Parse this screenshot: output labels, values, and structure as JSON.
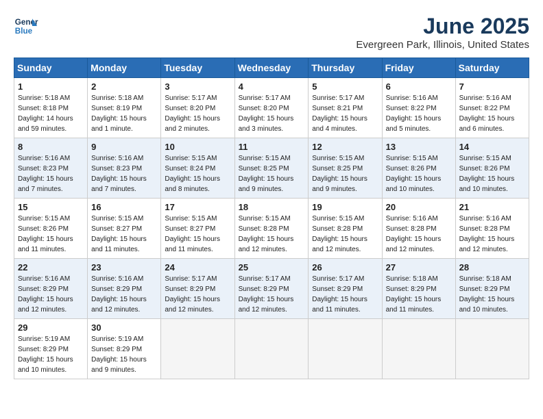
{
  "logo": {
    "line1": "General",
    "line2": "Blue"
  },
  "title": "June 2025",
  "subtitle": "Evergreen Park, Illinois, United States",
  "days_of_week": [
    "Sunday",
    "Monday",
    "Tuesday",
    "Wednesday",
    "Thursday",
    "Friday",
    "Saturday"
  ],
  "weeks": [
    [
      {
        "day": "1",
        "info": "Sunrise: 5:18 AM\nSunset: 8:18 PM\nDaylight: 14 hours\nand 59 minutes."
      },
      {
        "day": "2",
        "info": "Sunrise: 5:18 AM\nSunset: 8:19 PM\nDaylight: 15 hours\nand 1 minute."
      },
      {
        "day": "3",
        "info": "Sunrise: 5:17 AM\nSunset: 8:20 PM\nDaylight: 15 hours\nand 2 minutes."
      },
      {
        "day": "4",
        "info": "Sunrise: 5:17 AM\nSunset: 8:20 PM\nDaylight: 15 hours\nand 3 minutes."
      },
      {
        "day": "5",
        "info": "Sunrise: 5:17 AM\nSunset: 8:21 PM\nDaylight: 15 hours\nand 4 minutes."
      },
      {
        "day": "6",
        "info": "Sunrise: 5:16 AM\nSunset: 8:22 PM\nDaylight: 15 hours\nand 5 minutes."
      },
      {
        "day": "7",
        "info": "Sunrise: 5:16 AM\nSunset: 8:22 PM\nDaylight: 15 hours\nand 6 minutes."
      }
    ],
    [
      {
        "day": "8",
        "info": "Sunrise: 5:16 AM\nSunset: 8:23 PM\nDaylight: 15 hours\nand 7 minutes."
      },
      {
        "day": "9",
        "info": "Sunrise: 5:16 AM\nSunset: 8:23 PM\nDaylight: 15 hours\nand 7 minutes."
      },
      {
        "day": "10",
        "info": "Sunrise: 5:15 AM\nSunset: 8:24 PM\nDaylight: 15 hours\nand 8 minutes."
      },
      {
        "day": "11",
        "info": "Sunrise: 5:15 AM\nSunset: 8:25 PM\nDaylight: 15 hours\nand 9 minutes."
      },
      {
        "day": "12",
        "info": "Sunrise: 5:15 AM\nSunset: 8:25 PM\nDaylight: 15 hours\nand 9 minutes."
      },
      {
        "day": "13",
        "info": "Sunrise: 5:15 AM\nSunset: 8:26 PM\nDaylight: 15 hours\nand 10 minutes."
      },
      {
        "day": "14",
        "info": "Sunrise: 5:15 AM\nSunset: 8:26 PM\nDaylight: 15 hours\nand 10 minutes."
      }
    ],
    [
      {
        "day": "15",
        "info": "Sunrise: 5:15 AM\nSunset: 8:26 PM\nDaylight: 15 hours\nand 11 minutes."
      },
      {
        "day": "16",
        "info": "Sunrise: 5:15 AM\nSunset: 8:27 PM\nDaylight: 15 hours\nand 11 minutes."
      },
      {
        "day": "17",
        "info": "Sunrise: 5:15 AM\nSunset: 8:27 PM\nDaylight: 15 hours\nand 11 minutes."
      },
      {
        "day": "18",
        "info": "Sunrise: 5:15 AM\nSunset: 8:28 PM\nDaylight: 15 hours\nand 12 minutes."
      },
      {
        "day": "19",
        "info": "Sunrise: 5:15 AM\nSunset: 8:28 PM\nDaylight: 15 hours\nand 12 minutes."
      },
      {
        "day": "20",
        "info": "Sunrise: 5:16 AM\nSunset: 8:28 PM\nDaylight: 15 hours\nand 12 minutes."
      },
      {
        "day": "21",
        "info": "Sunrise: 5:16 AM\nSunset: 8:28 PM\nDaylight: 15 hours\nand 12 minutes."
      }
    ],
    [
      {
        "day": "22",
        "info": "Sunrise: 5:16 AM\nSunset: 8:29 PM\nDaylight: 15 hours\nand 12 minutes."
      },
      {
        "day": "23",
        "info": "Sunrise: 5:16 AM\nSunset: 8:29 PM\nDaylight: 15 hours\nand 12 minutes."
      },
      {
        "day": "24",
        "info": "Sunrise: 5:17 AM\nSunset: 8:29 PM\nDaylight: 15 hours\nand 12 minutes."
      },
      {
        "day": "25",
        "info": "Sunrise: 5:17 AM\nSunset: 8:29 PM\nDaylight: 15 hours\nand 12 minutes."
      },
      {
        "day": "26",
        "info": "Sunrise: 5:17 AM\nSunset: 8:29 PM\nDaylight: 15 hours\nand 11 minutes."
      },
      {
        "day": "27",
        "info": "Sunrise: 5:18 AM\nSunset: 8:29 PM\nDaylight: 15 hours\nand 11 minutes."
      },
      {
        "day": "28",
        "info": "Sunrise: 5:18 AM\nSunset: 8:29 PM\nDaylight: 15 hours\nand 10 minutes."
      }
    ],
    [
      {
        "day": "29",
        "info": "Sunrise: 5:19 AM\nSunset: 8:29 PM\nDaylight: 15 hours\nand 10 minutes."
      },
      {
        "day": "30",
        "info": "Sunrise: 5:19 AM\nSunset: 8:29 PM\nDaylight: 15 hours\nand 9 minutes."
      },
      {
        "day": "",
        "info": ""
      },
      {
        "day": "",
        "info": ""
      },
      {
        "day": "",
        "info": ""
      },
      {
        "day": "",
        "info": ""
      },
      {
        "day": "",
        "info": ""
      }
    ]
  ]
}
